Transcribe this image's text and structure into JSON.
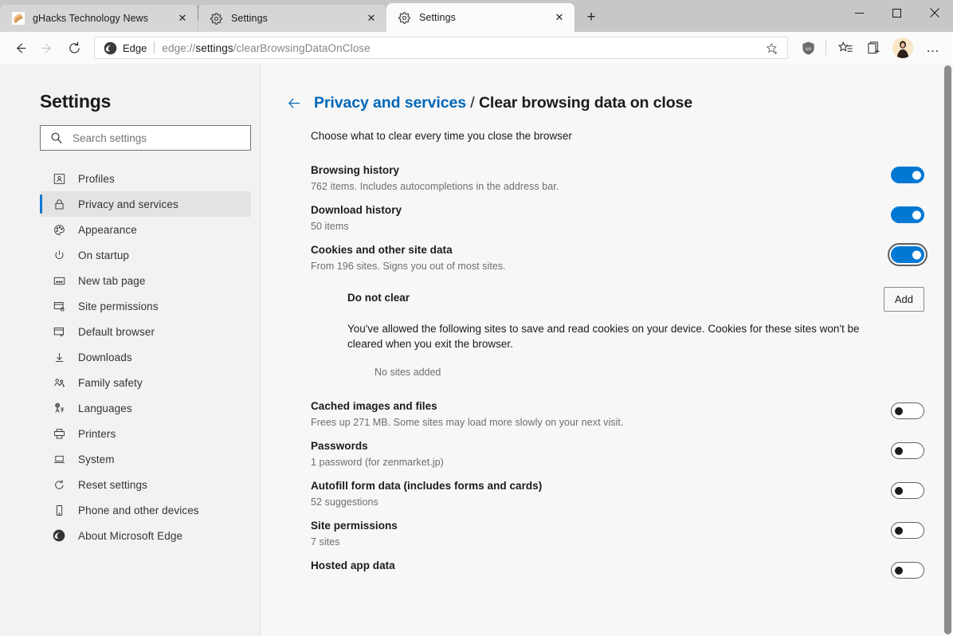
{
  "window": {
    "minimize_label": "Minimize",
    "maximize_label": "Maximize",
    "close_label": "Close"
  },
  "tabs": [
    {
      "title": "gHacks Technology News",
      "favicon": "ghacks-favicon",
      "active": false,
      "close_label": "✕"
    },
    {
      "title": "Settings",
      "favicon": "gear-icon",
      "active": false,
      "close_label": "✕"
    },
    {
      "title": "Settings",
      "favicon": "gear-icon",
      "active": true,
      "close_label": "✕"
    }
  ],
  "newtab_label": "+",
  "toolbar": {
    "back_label": "←",
    "forward_label": "→",
    "refresh_label": "↻",
    "brand_text": "Edge",
    "url_prefix": "edge://",
    "url_bold": "settings",
    "url_suffix": "/clearBrowsingDataOnClose",
    "url_full": "edge://settings/clearBrowsingDataOnClose",
    "icons": {
      "add_favorite": "star-plus-icon",
      "extension_ublock": "ublock-origin-icon",
      "favorites": "favorites-list-icon",
      "collections": "collections-icon",
      "profile": "profile-avatar",
      "more": "more-settings-icon"
    },
    "more_label": "…"
  },
  "sidebar": {
    "title": "Settings",
    "search": {
      "placeholder": "Search settings",
      "value": ""
    },
    "items": [
      {
        "label": "Profiles",
        "icon": "profiles-icon",
        "active": false
      },
      {
        "label": "Privacy and services",
        "icon": "lock-icon",
        "active": true
      },
      {
        "label": "Appearance",
        "icon": "palette-icon",
        "active": false
      },
      {
        "label": "On startup",
        "icon": "power-icon",
        "active": false
      },
      {
        "label": "New tab page",
        "icon": "new-tab-page-icon",
        "active": false
      },
      {
        "label": "Site permissions",
        "icon": "site-permissions-icon",
        "active": false
      },
      {
        "label": "Default browser",
        "icon": "default-browser-icon",
        "active": false
      },
      {
        "label": "Downloads",
        "icon": "download-icon",
        "active": false
      },
      {
        "label": "Family safety",
        "icon": "family-icon",
        "active": false
      },
      {
        "label": "Languages",
        "icon": "languages-icon",
        "active": false
      },
      {
        "label": "Printers",
        "icon": "printer-icon",
        "active": false
      },
      {
        "label": "System",
        "icon": "system-icon",
        "active": false
      },
      {
        "label": "Reset settings",
        "icon": "reset-icon",
        "active": false
      },
      {
        "label": "Phone and other devices",
        "icon": "phone-icon",
        "active": false
      },
      {
        "label": "About Microsoft Edge",
        "icon": "edge-logo-icon",
        "active": false
      }
    ]
  },
  "main": {
    "back_label": "←",
    "breadcrumb_parent": "Privacy and services",
    "breadcrumb_separator": " / ",
    "breadcrumb_current": "Clear browsing data on close",
    "subtitle": "Choose what to clear every time you close the browser",
    "settings": [
      {
        "title": "Browsing history",
        "description": "762 items. Includes autocompletions in the address bar.",
        "toggle": "on",
        "focused": false
      },
      {
        "title": "Download history",
        "description": "50 items",
        "toggle": "on",
        "focused": false
      },
      {
        "title": "Cookies and other site data",
        "description": "From 196 sites. Signs you out of most sites.",
        "toggle": "on",
        "focused": true
      },
      {
        "title": "Cached images and files",
        "description": "Frees up 271 MB. Some sites may load more slowly on your next visit.",
        "toggle": "off",
        "focused": false
      },
      {
        "title": "Passwords",
        "description": "1 password (for zenmarket.jp)",
        "toggle": "off",
        "focused": false
      },
      {
        "title": "Autofill form data (includes forms and cards)",
        "description": "52 suggestions",
        "toggle": "off",
        "focused": false
      },
      {
        "title": "Site permissions",
        "description": "7 sites",
        "toggle": "off",
        "focused": false
      },
      {
        "title": "Hosted app data",
        "description": "",
        "toggle": "off",
        "focused": false
      }
    ],
    "do_not_clear": {
      "title": "Do not clear",
      "add_label": "Add",
      "description": "You've allowed the following sites to save and read cookies on your device. Cookies for these sites won't be cleared when you exit the browser.",
      "empty_text": "No sites added"
    }
  },
  "colors": {
    "accent": "#0078d4",
    "link": "#0067b8",
    "tabbar": "#c7c7c7",
    "content_bg": "#f7f7f7",
    "sidebar_bg": "#f2f2f2"
  }
}
